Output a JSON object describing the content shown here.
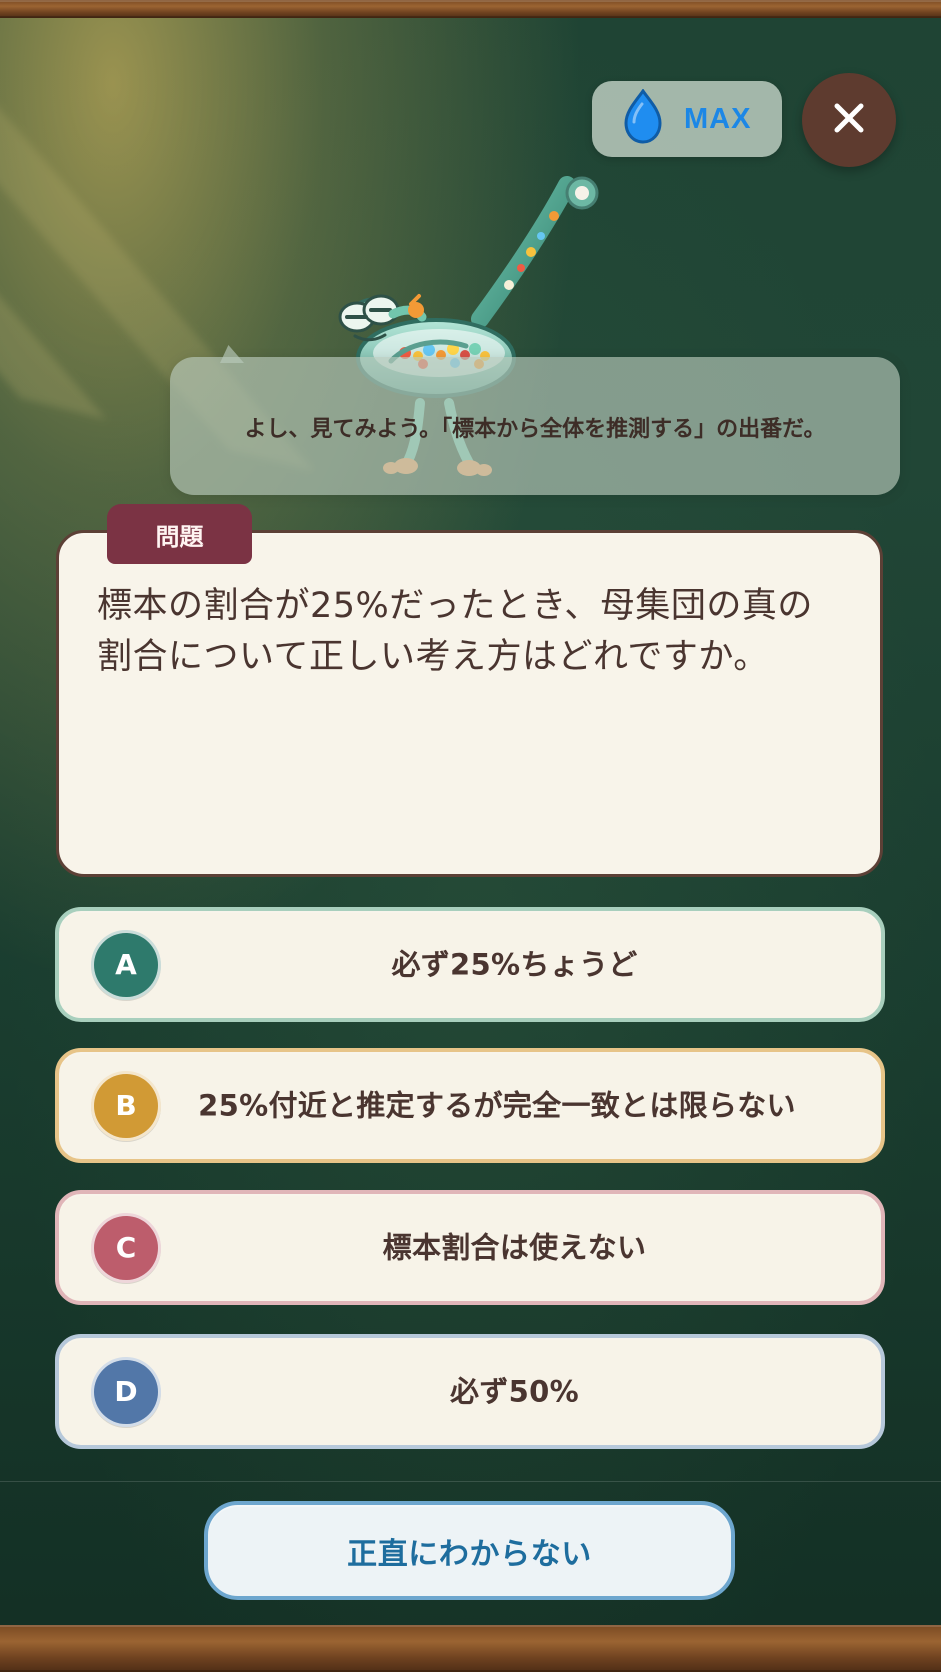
{
  "top_bar": {
    "water_level_label": "MAX",
    "drop_icon": "water-drop-icon",
    "close_icon": "close-icon"
  },
  "speech_bubble": {
    "text": "よし、見てみよう。「標本から全体を推測する」の出番だ。"
  },
  "question": {
    "tag": "問題",
    "text": "標本の割合が25%だったとき、母集団の真の割合について正しい考え方はどれですか。"
  },
  "answers": [
    {
      "letter": "A",
      "text": "必ず25%ちょうど",
      "color": "#2e7a6c",
      "border": "#a8cfbd"
    },
    {
      "letter": "B",
      "text": "25%付近と推定するが完全一致とは限らない",
      "color": "#d19a35",
      "border": "#e7c488"
    },
    {
      "letter": "C",
      "text": "標本割合は使えない",
      "color": "#bd5d6c",
      "border": "#e0b5b8"
    },
    {
      "letter": "D",
      "text": "必ず50%",
      "color": "#5277a8",
      "border": "#b6c8da"
    }
  ],
  "footer": {
    "unsure_button": "正直にわからない"
  }
}
